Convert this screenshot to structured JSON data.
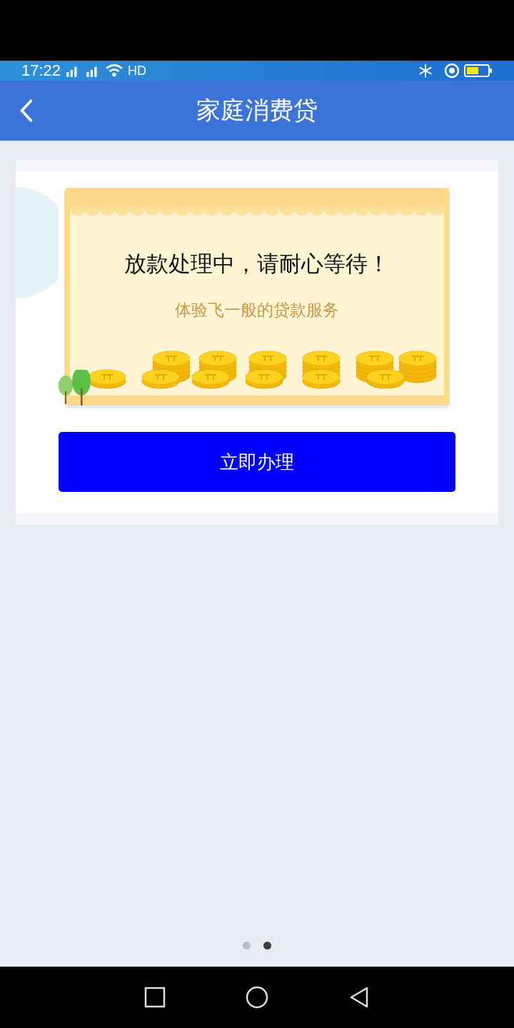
{
  "status_bar": {
    "time": "17:22",
    "network_label": "HD"
  },
  "header": {
    "title": "家庭消费贷"
  },
  "banner": {
    "headline": "放款处理中，请耐心等待！",
    "subtitle": "体验飞一般的贷款服务"
  },
  "action_button": {
    "label": "立即办理"
  },
  "pager": [
    {
      "selected": false
    },
    {
      "selected": true
    }
  ]
}
